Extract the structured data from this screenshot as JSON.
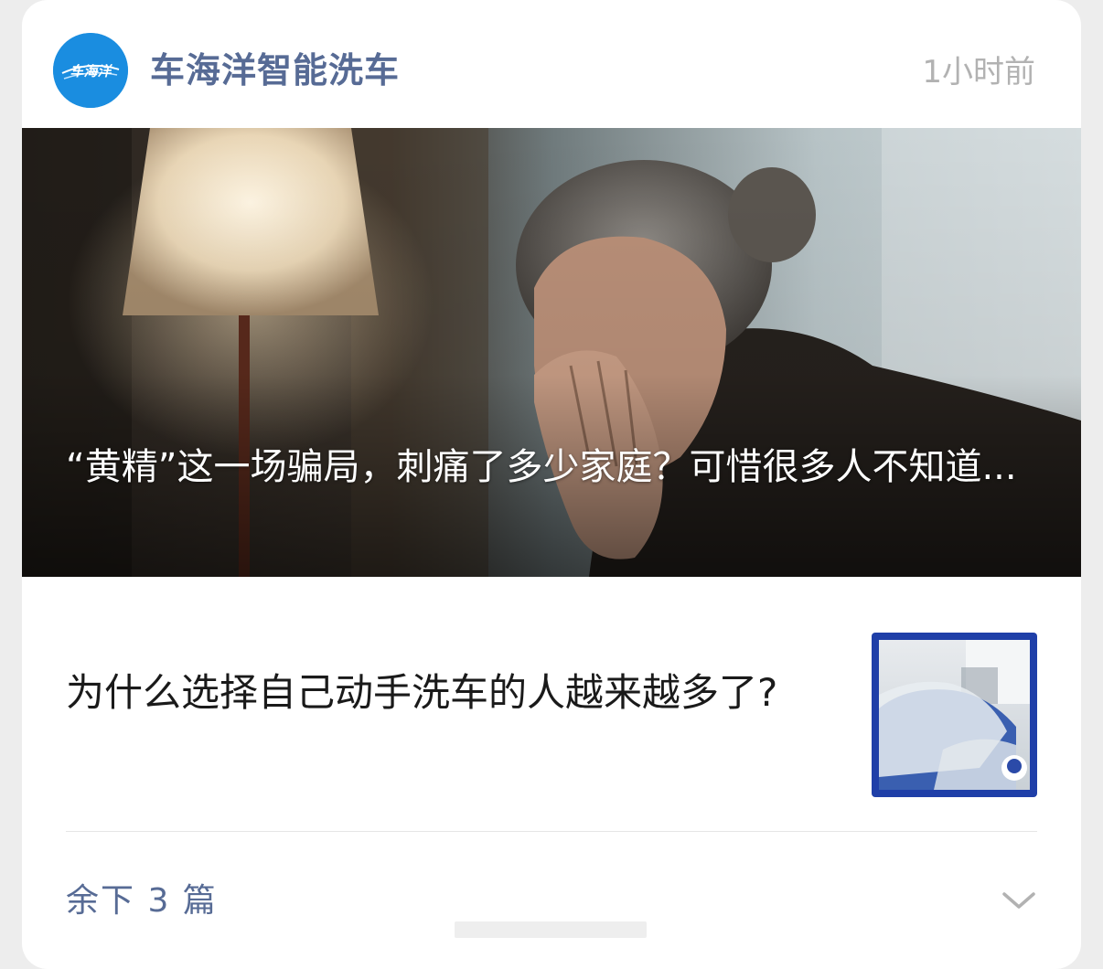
{
  "header": {
    "account_name": "车海洋智能洗车",
    "timestamp": "1小时前",
    "avatar_text": "车海洋"
  },
  "hero_article": {
    "title": "“黄精”这一场骗局，刺痛了多少家庭？可惜很多人不知道..."
  },
  "sub_article": {
    "title": "为什么选择自己动手洗车的人越来越多了?"
  },
  "footer": {
    "more_label": "余下 3 篇",
    "chevron_icon": "chevron-down-icon"
  },
  "colors": {
    "link_blue": "#576b95",
    "avatar_blue": "#1a8de0",
    "thumb_border": "#1f3fa8"
  }
}
